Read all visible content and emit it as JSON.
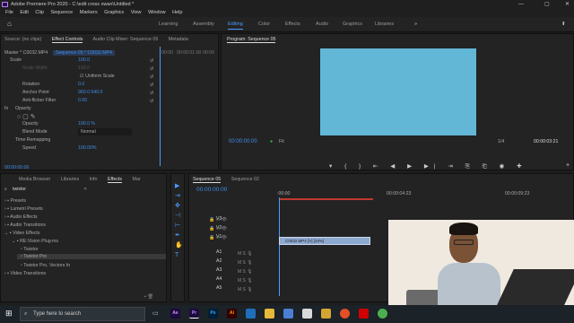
{
  "window": {
    "title": "Adobe Premiere Pro 2020 - C:\\edit cross swan\\Untitled *"
  },
  "menu": [
    "File",
    "Edit",
    "Clip",
    "Sequence",
    "Markers",
    "Graphics",
    "View",
    "Window",
    "Help"
  ],
  "workspaces": [
    "Learning",
    "Assembly",
    "Editing",
    "Color",
    "Effects",
    "Audio",
    "Graphics",
    "Libraries"
  ],
  "source_tabs": {
    "source": "Source: (no clips)",
    "effect_controls": "Effect Controls",
    "audio_mixer": "Audio Clip Mixer: Sequence 05",
    "metadata": "Metadata"
  },
  "effect_controls": {
    "master": "Master * C0032.MP4",
    "sequence": "Sequence 05 * C0032.MP4",
    "ruler_start": "00:00",
    "ruler_mid": "00:00:01:00",
    "ruler_end": "00:00",
    "params": [
      {
        "name": "Scale",
        "value": "100.0"
      },
      {
        "name": "Scale Width",
        "value": "100.0"
      },
      {
        "name": "",
        "value": "Uniform Scale"
      },
      {
        "name": "Rotation",
        "value": "0.0"
      },
      {
        "name": "Anchor Point",
        "value": "960.0    540.0"
      },
      {
        "name": "Anti-flicker Filter",
        "value": "0.00"
      }
    ],
    "opacity_section": "Opacity",
    "opacity_label": "Opacity",
    "opacity_value": "100.0 %",
    "blend_label": "Blend Mode",
    "blend_value": "Normal",
    "remap_section": "Time Remapping",
    "speed_label": "Speed",
    "speed_value": "100.00%",
    "timecode": "00:00:00:00"
  },
  "program": {
    "title": "Program: Sequence 05",
    "timecode": "00:00:00:00",
    "fit": "Fit",
    "ratio": "1/4",
    "duration": "00:00:03:21"
  },
  "project_tabs": [
    "Media Browser",
    "Libraries",
    "Info",
    "Effects",
    "Mar"
  ],
  "effects_search": "twixtor",
  "effects_tree": [
    "Presets",
    "Lumetri Presets",
    "Audio Effects",
    "Audio Transitions",
    "Video Effects",
    "RE:Vision Plug-ins",
    "Twixtor",
    "Twixtor Pro",
    "Twixtor Pro, Vectors In",
    "Video Transitions"
  ],
  "timeline": {
    "tab1": "Sequence 05",
    "tab2": "Sequence 02",
    "timecode": "00:00:00:00",
    "t0": ":00:00",
    "t1": "00:00:04:23",
    "t2": "00:00:09:23",
    "video_tracks": [
      "V3",
      "V2",
      "V1"
    ],
    "audio_tracks": [
      "A1",
      "A2",
      "A3",
      "A4",
      "A5"
    ],
    "clip_label": "C0032.MP4 [V] [33%]"
  },
  "taskbar": {
    "search_placeholder": "Type here to search",
    "apps": [
      "Ae",
      "Pr",
      "Ps",
      "Ai"
    ]
  },
  "colors": {
    "accent": "#4a9cff",
    "clip": "#8ea9d0",
    "monitor": "#62b6d6"
  }
}
